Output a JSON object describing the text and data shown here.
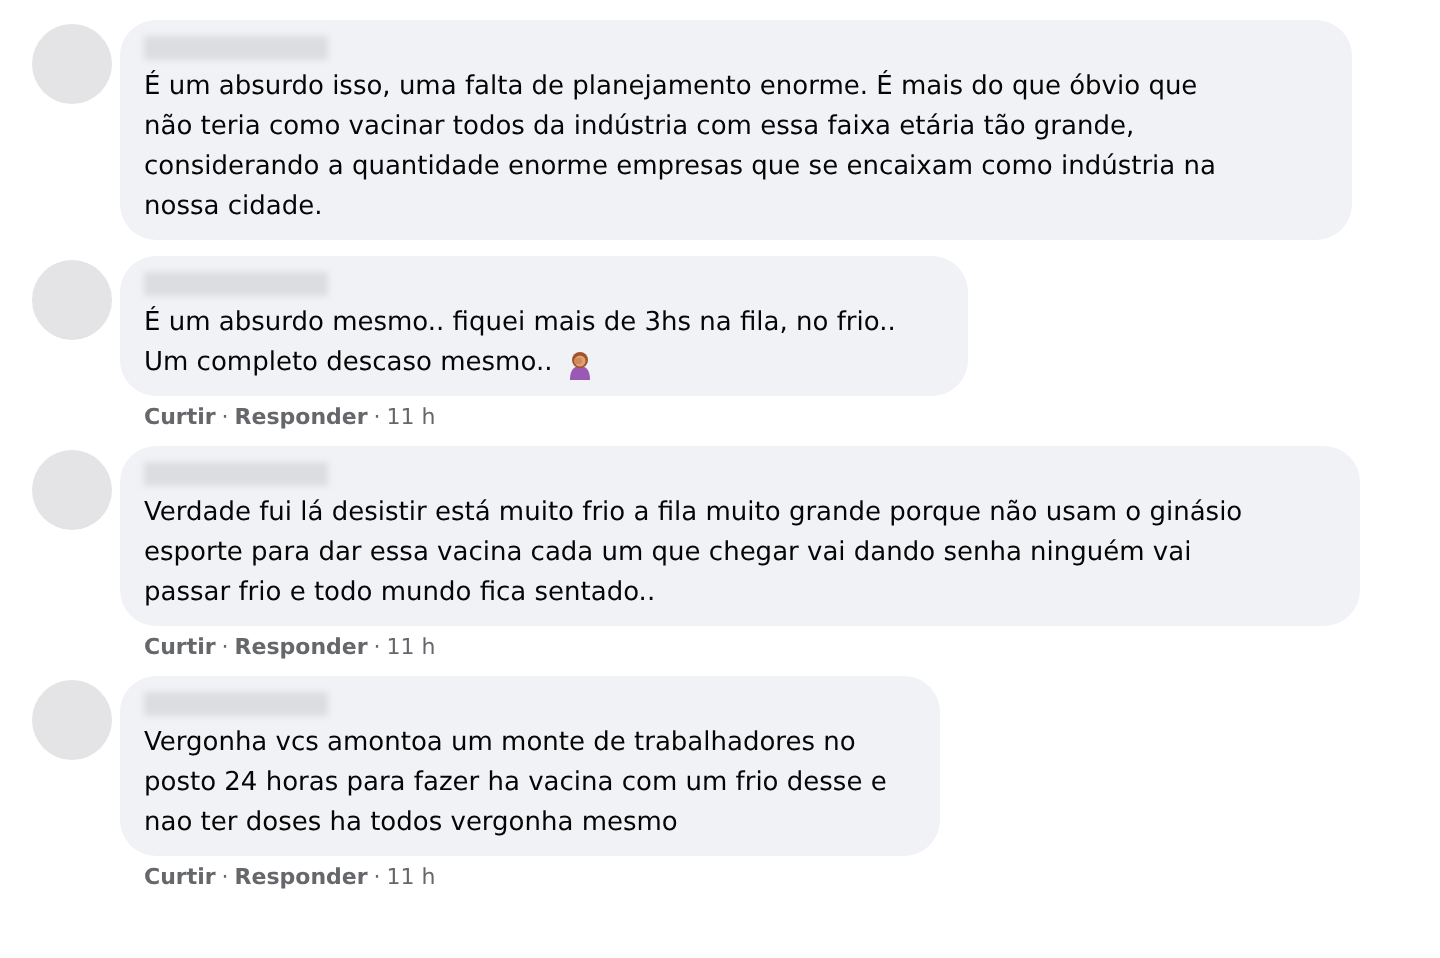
{
  "comments": [
    {
      "lines": [
        "É um absurdo isso, uma falta de planejamento enorme. É mais do que óbvio que",
        "não teria como vacinar todos da indústria com essa faixa etária tão grande,",
        "considerando a quantidade enorme empresas que se encaixam como indústria na",
        "nossa cidade."
      ],
      "emoji": false
    },
    {
      "lines": [
        "É um absurdo mesmo.. fiquei mais de 3hs na fila, no frio..",
        "Um completo descaso mesmo.."
      ],
      "emoji": true,
      "actions": {
        "like": "Curtir",
        "separator": "·",
        "reply": "Responder",
        "time": "11 h"
      }
    },
    {
      "lines": [
        "Verdade fui lá desistir está muito frio a fila muito grande porque não usam o ginásio",
        "esporte para dar essa vacina cada um que chegar vai dando senha ninguém vai",
        "passar frio e todo mundo fica sentado.."
      ],
      "emoji": false,
      "actions": {
        "like": "Curtir",
        "separator": "·",
        "reply": "Responder",
        "time": "11 h"
      }
    },
    {
      "lines": [
        "Vergonha vcs amontoa um monte de trabalhadores no",
        "posto 24 horas para fazer ha vacina com um frio desse e",
        "nao ter doses ha todos vergonha mesmo"
      ],
      "emoji": false,
      "actions": {
        "like": "Curtir",
        "separator": "·",
        "reply": "Responder",
        "time": "11 h"
      }
    }
  ]
}
